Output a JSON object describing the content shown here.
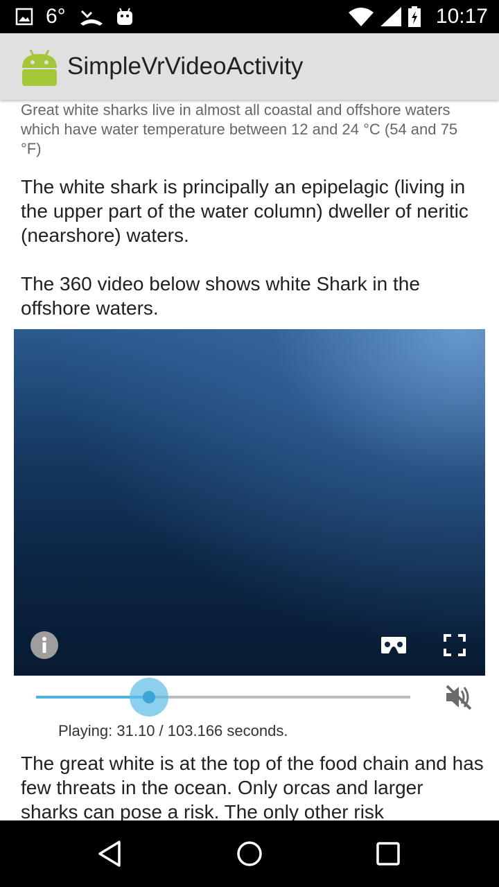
{
  "status_bar": {
    "temperature": "6°",
    "time": "10:17",
    "icons": [
      "image-icon",
      "missed-call-icon",
      "android-debug-icon",
      "wifi-icon",
      "cell-signal-icon",
      "battery-charging-icon"
    ]
  },
  "app_bar": {
    "title": "SimpleVrVideoActivity",
    "logo": "android-robot-icon"
  },
  "content": {
    "intro_small": "Great white sharks live in almost all coastal and offshore waters which have water temperature between 12 and 24 °C (54 and 75 °F)",
    "paragraph1": "The white shark is principally an epipelagic (living in the upper part of the water column) dweller of neritic (nearshore) waters.",
    "paragraph2": "The 360 video below shows white Shark in the offshore waters.",
    "paragraph3": "The great white is at the top of the food chain and has few threats in the ocean. Only orcas and larger sharks can pose a risk. The only other risk"
  },
  "video": {
    "icons": [
      "info-icon",
      "cardboard-vr-icon",
      "fullscreen-icon"
    ],
    "progress_current": 31.1,
    "progress_total": 103.166,
    "status_text": "Playing: 31.10 / 103.166 seconds.",
    "mute_icon": "volume-off-icon"
  },
  "colors": {
    "accent": "#4fb3d9",
    "app_bar": "#e0e0e0",
    "android_green": "#a4c639"
  },
  "nav_bar": {
    "icons": [
      "back-icon",
      "home-icon",
      "recents-icon"
    ]
  }
}
